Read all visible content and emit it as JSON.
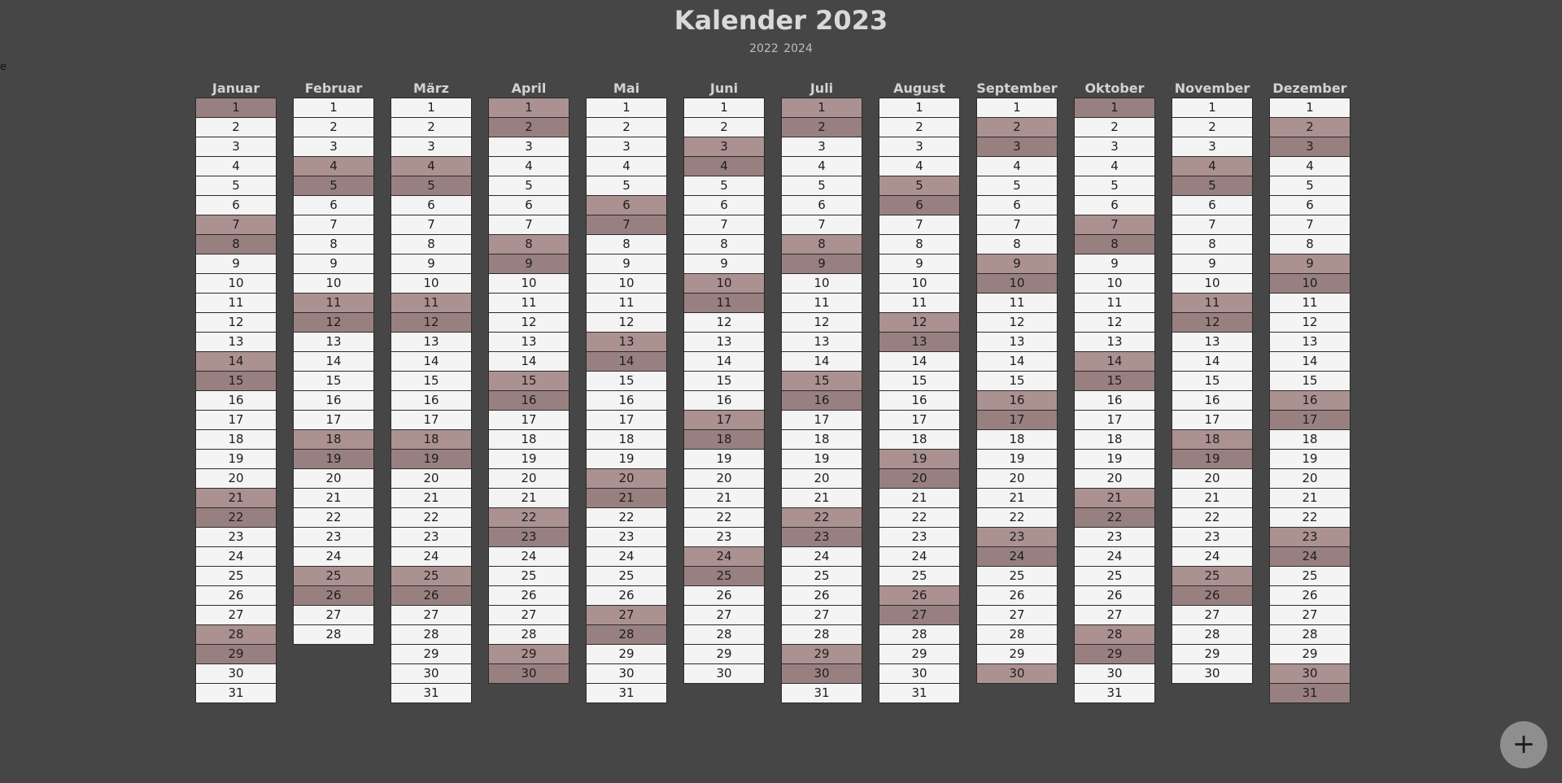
{
  "header": {
    "title": "Kalender 2023",
    "prev_year": "2022",
    "next_year": "2024"
  },
  "stray_text": "e",
  "calendar": {
    "year": 2023,
    "months": [
      {
        "name": "Januar",
        "days": 31
      },
      {
        "name": "Februar",
        "days": 28
      },
      {
        "name": "März",
        "days": 31
      },
      {
        "name": "April",
        "days": 30
      },
      {
        "name": "Mai",
        "days": 31
      },
      {
        "name": "Juni",
        "days": 30
      },
      {
        "name": "Juli",
        "days": 31
      },
      {
        "name": "August",
        "days": 31
      },
      {
        "name": "September",
        "days": 30
      },
      {
        "name": "Oktober",
        "days": 31
      },
      {
        "name": "November",
        "days": 30
      },
      {
        "name": "Dezember",
        "days": 31
      }
    ],
    "colors": {
      "weekday": "#f4f4f4",
      "saturday": "#ac9191",
      "sunday": "#988081"
    }
  },
  "fab": {
    "label": "+",
    "icon": "plus-icon"
  }
}
